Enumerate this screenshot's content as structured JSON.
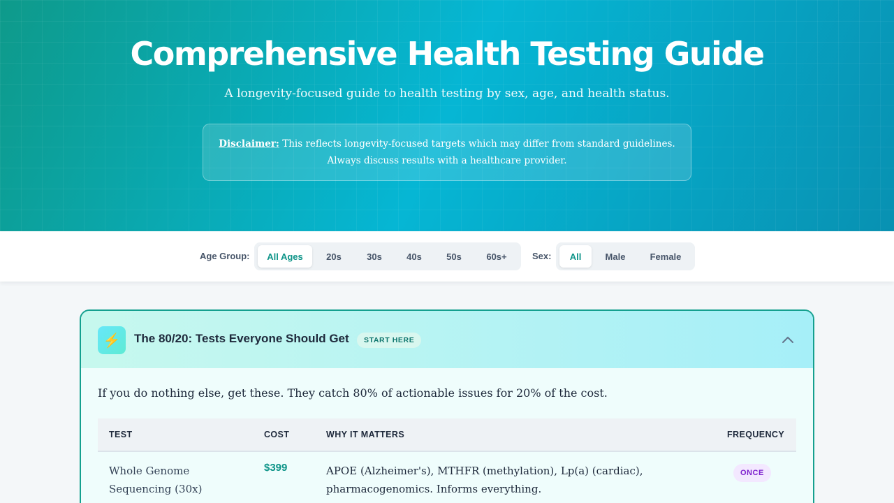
{
  "hero": {
    "title": "Comprehensive Health Testing Guide",
    "subtitle": "A longevity-focused guide to health testing by sex, age, and health status.",
    "disclaimer_label": "Disclaimer:",
    "disclaimer_line1": "This reflects longevity-focused targets which may differ from standard guidelines.",
    "disclaimer_line2": "Always discuss results with a healthcare provider."
  },
  "filters": {
    "age_label": "Age Group:",
    "age_options": [
      "All Ages",
      "20s",
      "30s",
      "40s",
      "50s",
      "60s+"
    ],
    "age_selected": "All Ages",
    "sex_label": "Sex:",
    "sex_options": [
      "All",
      "Male",
      "Female"
    ],
    "sex_selected": "All"
  },
  "card": {
    "icon": "lightning-bolt-icon",
    "title": "The 80/20: Tests Everyone Should Get",
    "badge": "START HERE",
    "intro": "If you do nothing else, get these. They catch 80% of actionable issues for 20% of the cost.",
    "columns": [
      "TEST",
      "COST",
      "WHY IT MATTERS",
      "FREQUENCY"
    ],
    "rows": [
      {
        "test": "Whole Genome Sequencing (30x)",
        "cost": "$399",
        "why": "APOE (Alzheimer's), MTHFR (methylation), Lp(a) (cardiac), pharmacogenomics. Informs everything.",
        "frequency": "ONCE"
      }
    ]
  },
  "colors": {
    "accent": "#0d9488",
    "hero_start": "#0e9a8a",
    "hero_end": "#0891b2",
    "frequency_pill": "#7e22ce"
  }
}
